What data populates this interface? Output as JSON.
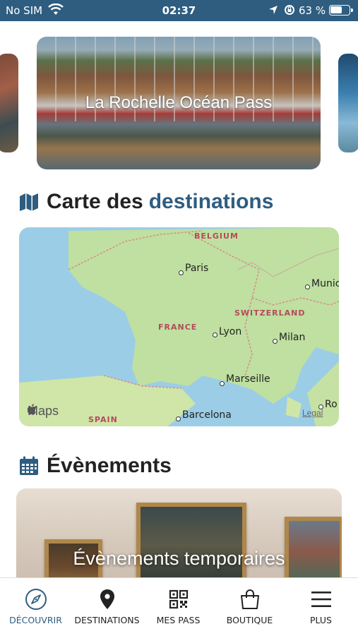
{
  "status_bar": {
    "carrier": "No SIM",
    "time": "02:37",
    "battery": "63 %",
    "battery_level": 0.63
  },
  "hero": {
    "title": "La Rochelle Océan Pass"
  },
  "map_section": {
    "title_part1": "Carte des",
    "title_part2": "destinations",
    "countries": [
      "BELGIUM",
      "SWITZERLAND",
      "FRANCE",
      "SPAIN"
    ],
    "cities": [
      "Paris",
      "Munic",
      "Lyon",
      "Milan",
      "Marseille",
      "Barcelona",
      "Ro"
    ],
    "logo": "Maps",
    "legal": "Legal"
  },
  "events_section": {
    "title": "Évènements",
    "card_title": "Évènements temporaires"
  },
  "tabs": [
    {
      "label": "DÉCOUVRIR",
      "icon": "compass-icon",
      "active": true
    },
    {
      "label": "DESTINATIONS",
      "icon": "map-pin-icon",
      "active": false
    },
    {
      "label": "MES PASS",
      "icon": "qr-code-icon",
      "active": false
    },
    {
      "label": "BOUTIQUE",
      "icon": "shopping-bag-icon",
      "active": false
    },
    {
      "label": "PLUS",
      "icon": "menu-icon",
      "active": false
    }
  ],
  "colors": {
    "accent": "#2e5d80",
    "status_bar": "#2e5d80",
    "map_water": "#9ccde6",
    "map_land": "#bfe0a0",
    "country_label": "#b54a5c"
  }
}
